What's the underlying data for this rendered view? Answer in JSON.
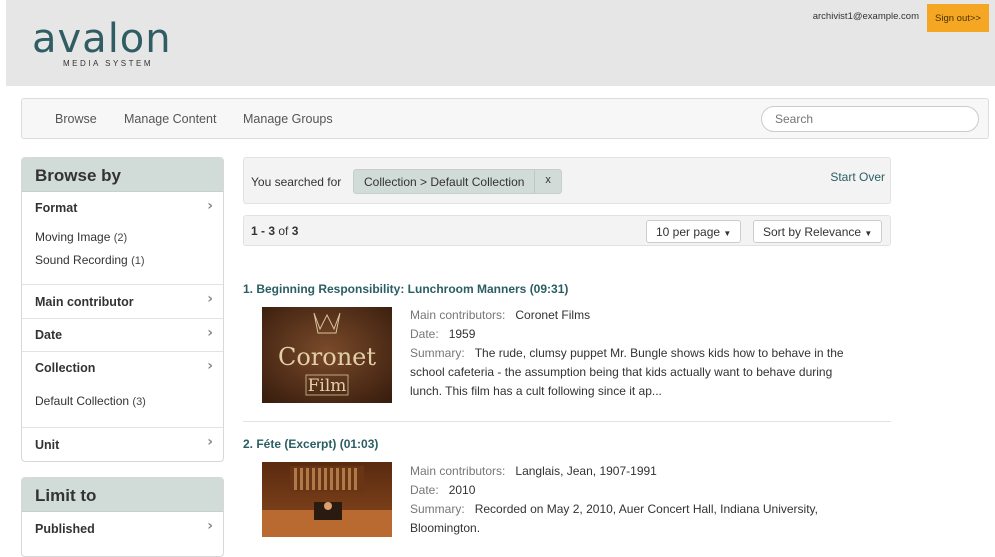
{
  "header": {
    "logo_text": "avalon",
    "logo_subtitle": "MEDIA SYSTEM",
    "user_email": "archivist1@example.com",
    "signout_label": "Sign out>>"
  },
  "nav": {
    "items": [
      "Browse",
      "Manage Content",
      "Manage Groups"
    ],
    "search_placeholder": "Search"
  },
  "browse_by": {
    "heading": "Browse by",
    "facets": [
      {
        "title": "Format",
        "values": [
          {
            "label": "Moving Image",
            "count": "(2)"
          },
          {
            "label": "Sound Recording",
            "count": "(1)"
          }
        ]
      },
      {
        "title": "Main contributor"
      },
      {
        "title": "Date"
      },
      {
        "title": "Collection",
        "values": [
          {
            "label": "Default Collection",
            "count": "(3)"
          }
        ]
      },
      {
        "title": "Unit"
      }
    ]
  },
  "limit_to": {
    "heading": "Limit to",
    "facets": [
      {
        "title": "Published"
      }
    ]
  },
  "constraints": {
    "label": "You searched for",
    "chip_text": "Collection > Default Collection",
    "chip_remove": "x",
    "start_over": "Start Over"
  },
  "sortbar": {
    "range_prefix": "1 - 3",
    "range_of": " of ",
    "range_total": "3",
    "per_page": "10 per page",
    "sort": "Sort by Relevance"
  },
  "results": [
    {
      "title": "1. Beginning Responsibility: Lunchroom Manners (09:31)",
      "contrib_label": "Main contributors:",
      "contrib": "Coronet Films",
      "date_label": "Date:",
      "date": "1959",
      "summary_label": "Summary:",
      "summary": "The rude, clumsy puppet Mr. Bungle shows kids how to behave in the school cafeteria - the assumption being that kids actually want to behave during lunch. This film has a cult following since it ap...",
      "thumb_text": [
        "Coronet",
        "Film"
      ]
    },
    {
      "title": "2. Féte (Excerpt) (01:03)",
      "contrib_label": "Main contributors:",
      "contrib": "Langlais, Jean, 1907-1991",
      "date_label": "Date:",
      "date": "2010",
      "summary_label": "Summary:",
      "summary": "Recorded on May 2, 2010, Auer Concert Hall, Indiana University, Bloomington."
    }
  ],
  "colors": {
    "accent": "#2b5e63",
    "signout_bg": "#f5a623",
    "panel_head": "#d1dbd8"
  }
}
